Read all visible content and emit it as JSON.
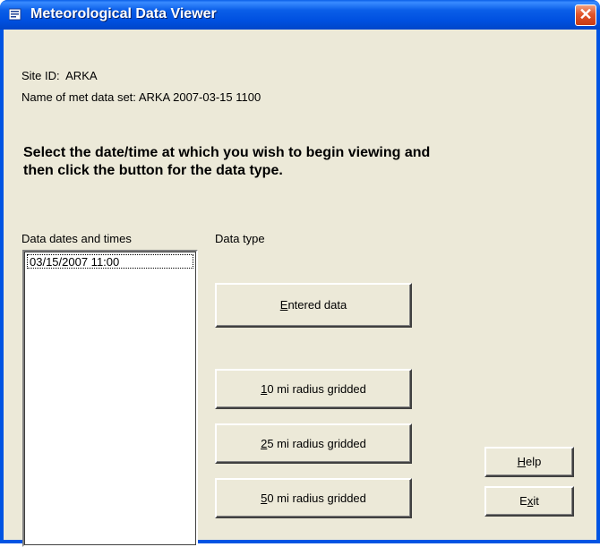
{
  "window": {
    "title": "Meteorological Data Viewer",
    "close_glyph": "✕"
  },
  "site": {
    "id_label": "Site ID:",
    "id_value": "ARKA",
    "dataset_label": "Name of met data set:",
    "dataset_value": "ARKA 2007-03-15 1100"
  },
  "instructions": "Select the date/time at which you wish to begin viewing and then click the button for the data type.",
  "list": {
    "header": "Data dates and times",
    "items": [
      "03/15/2007 11:00"
    ]
  },
  "data_type": {
    "header": "Data type",
    "buttons": [
      {
        "mnemonic": "E",
        "rest": "ntered data"
      },
      {
        "mnemonic": "1",
        "rest": "0 mi radius gridded"
      },
      {
        "mnemonic": "2",
        "rest": "5 mi radius gridded"
      },
      {
        "mnemonic": "5",
        "rest": "0 mi radius gridded"
      }
    ]
  },
  "help_button": {
    "mnemonic": "H",
    "rest": "elp"
  },
  "exit_button": {
    "prefix": "E",
    "mnemonic": "x",
    "rest": "it"
  }
}
